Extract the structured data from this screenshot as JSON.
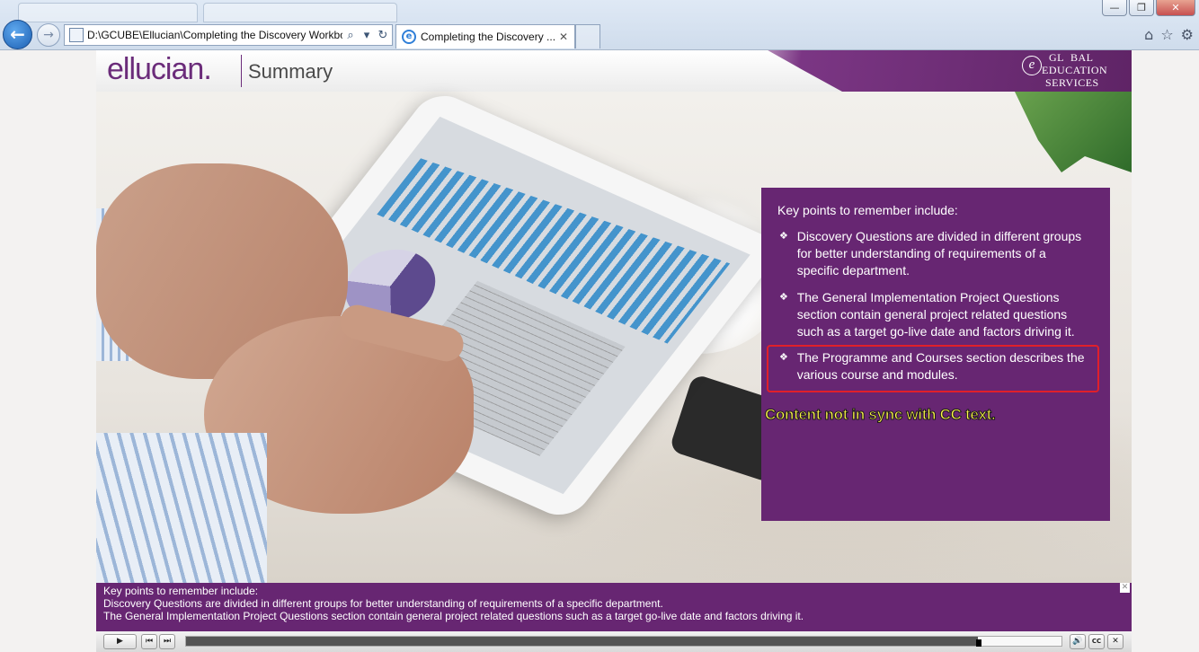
{
  "browser": {
    "ghost_tabs": [
      "",
      ""
    ],
    "address_url": "D:\\GCUBE\\Ellucian\\Completing the Discovery Workbo",
    "tab_title": "Completing the Discovery ...",
    "tab_close": "✕",
    "window_buttons": [
      "—",
      "❐",
      "✕"
    ],
    "nav_back": "←",
    "nav_forward": "→",
    "search_icon": "⌕",
    "dropdown_icon": "▾",
    "refresh_icon": "↻",
    "tools": [
      "⌂",
      "☆",
      "⚙"
    ]
  },
  "course": {
    "logo_text": "ellucian",
    "logo_trademark": ".",
    "title": "Summary",
    "ges_logo": {
      "mark": "e",
      "lines": [
        "GL",
        "BAL",
        "EDUCATION",
        "SERVICES"
      ]
    },
    "panel": {
      "intro": "Key points to remember include:",
      "bullet_mark": "❖",
      "bullets": [
        "Discovery Questions are divided in different groups for better understanding of requirements of a specific department.",
        "The General Implementation Project Questions section contain general project related questions such as a target go-live date and factors driving it.",
        "The Programme and Courses section describes the various course and modules."
      ],
      "annotation": "Content not in sync with CC text."
    },
    "captions": {
      "lines": [
        "Key points to remember include:",
        "Discovery Questions are divided in different groups for better understanding of requirements of a specific department.",
        "The General Implementation Project Questions section contain general project related questions such as a target go-live date and factors driving it."
      ],
      "close": "✕"
    }
  },
  "player": {
    "play_icon": "▶",
    "prev_icon": "⏮",
    "next_icon": "⏭",
    "progress": 0.905,
    "volume_icon": "🔊",
    "cc_label": "CC",
    "close_icon": "✕"
  },
  "colors": {
    "brand_purple": "#672672",
    "annotation_yellow": "#fff64a",
    "highlight_red": "#e0202a"
  }
}
